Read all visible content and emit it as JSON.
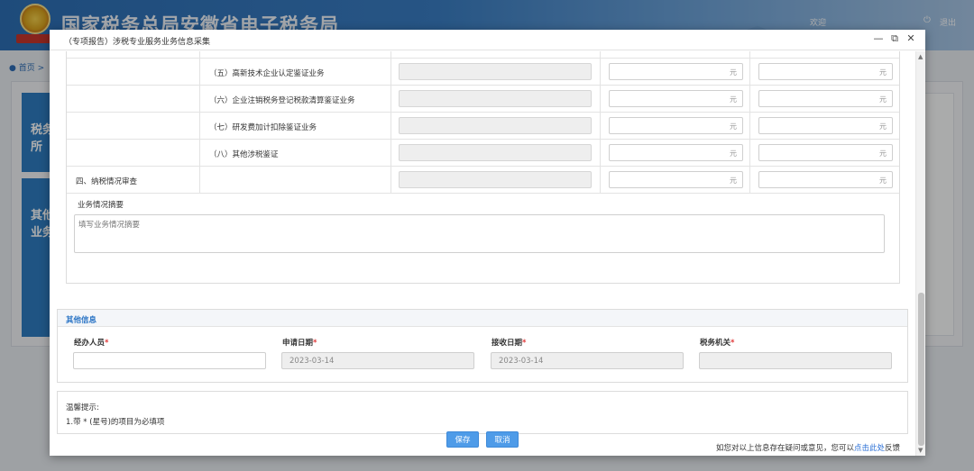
{
  "background": {
    "site_title": "国家税务总局安徽省电子税务局",
    "welcome": "欢迎",
    "logout": "退出",
    "breadcrumb_home": "首页",
    "breadcrumb_sep": ">",
    "card1_text": "税务\n所",
    "card2_text": "其他\n业务"
  },
  "dialog": {
    "title": "（专项报告）涉税专业服务业务信息采集",
    "min_icon": "—",
    "max_icon": "⧉",
    "close_icon": "✕"
  },
  "table": {
    "yuan": "元",
    "rows": [
      {
        "c1": "",
        "c2": ""
      },
      {
        "c1": "",
        "c2": "（五）高新技术企业认定鉴证业务"
      },
      {
        "c1": "",
        "c2": "（六）企业注销税务登记税款清算鉴证业务"
      },
      {
        "c1": "",
        "c2": "（七）研发费加计扣除鉴证业务"
      },
      {
        "c1": "",
        "c2": "（八）其他涉税鉴证"
      },
      {
        "c1": "四、纳税情况审查",
        "c2": ""
      }
    ],
    "summary_label": "业务情况摘要",
    "summary_placeholder": "填写业务情况摘要"
  },
  "other_info": {
    "section_title": "其他信息",
    "operator_label": "经办人员",
    "apply_date_label": "申请日期",
    "apply_date_value": "2023-03-14",
    "receive_date_label": "接收日期",
    "receive_date_value": "2023-03-14",
    "tax_authority_label": "税务机关",
    "required_mark": "*"
  },
  "tips": {
    "title": "温馨提示:",
    "text": "1.带 * (星号)的项目为必填项"
  },
  "footer": {
    "feedback_prefix": "如您对以上信息存在疑问或意见，您可以",
    "feedback_link": "点击此处",
    "feedback_suffix": "反馈",
    "save_label": "保存",
    "cancel_label": "取消"
  }
}
